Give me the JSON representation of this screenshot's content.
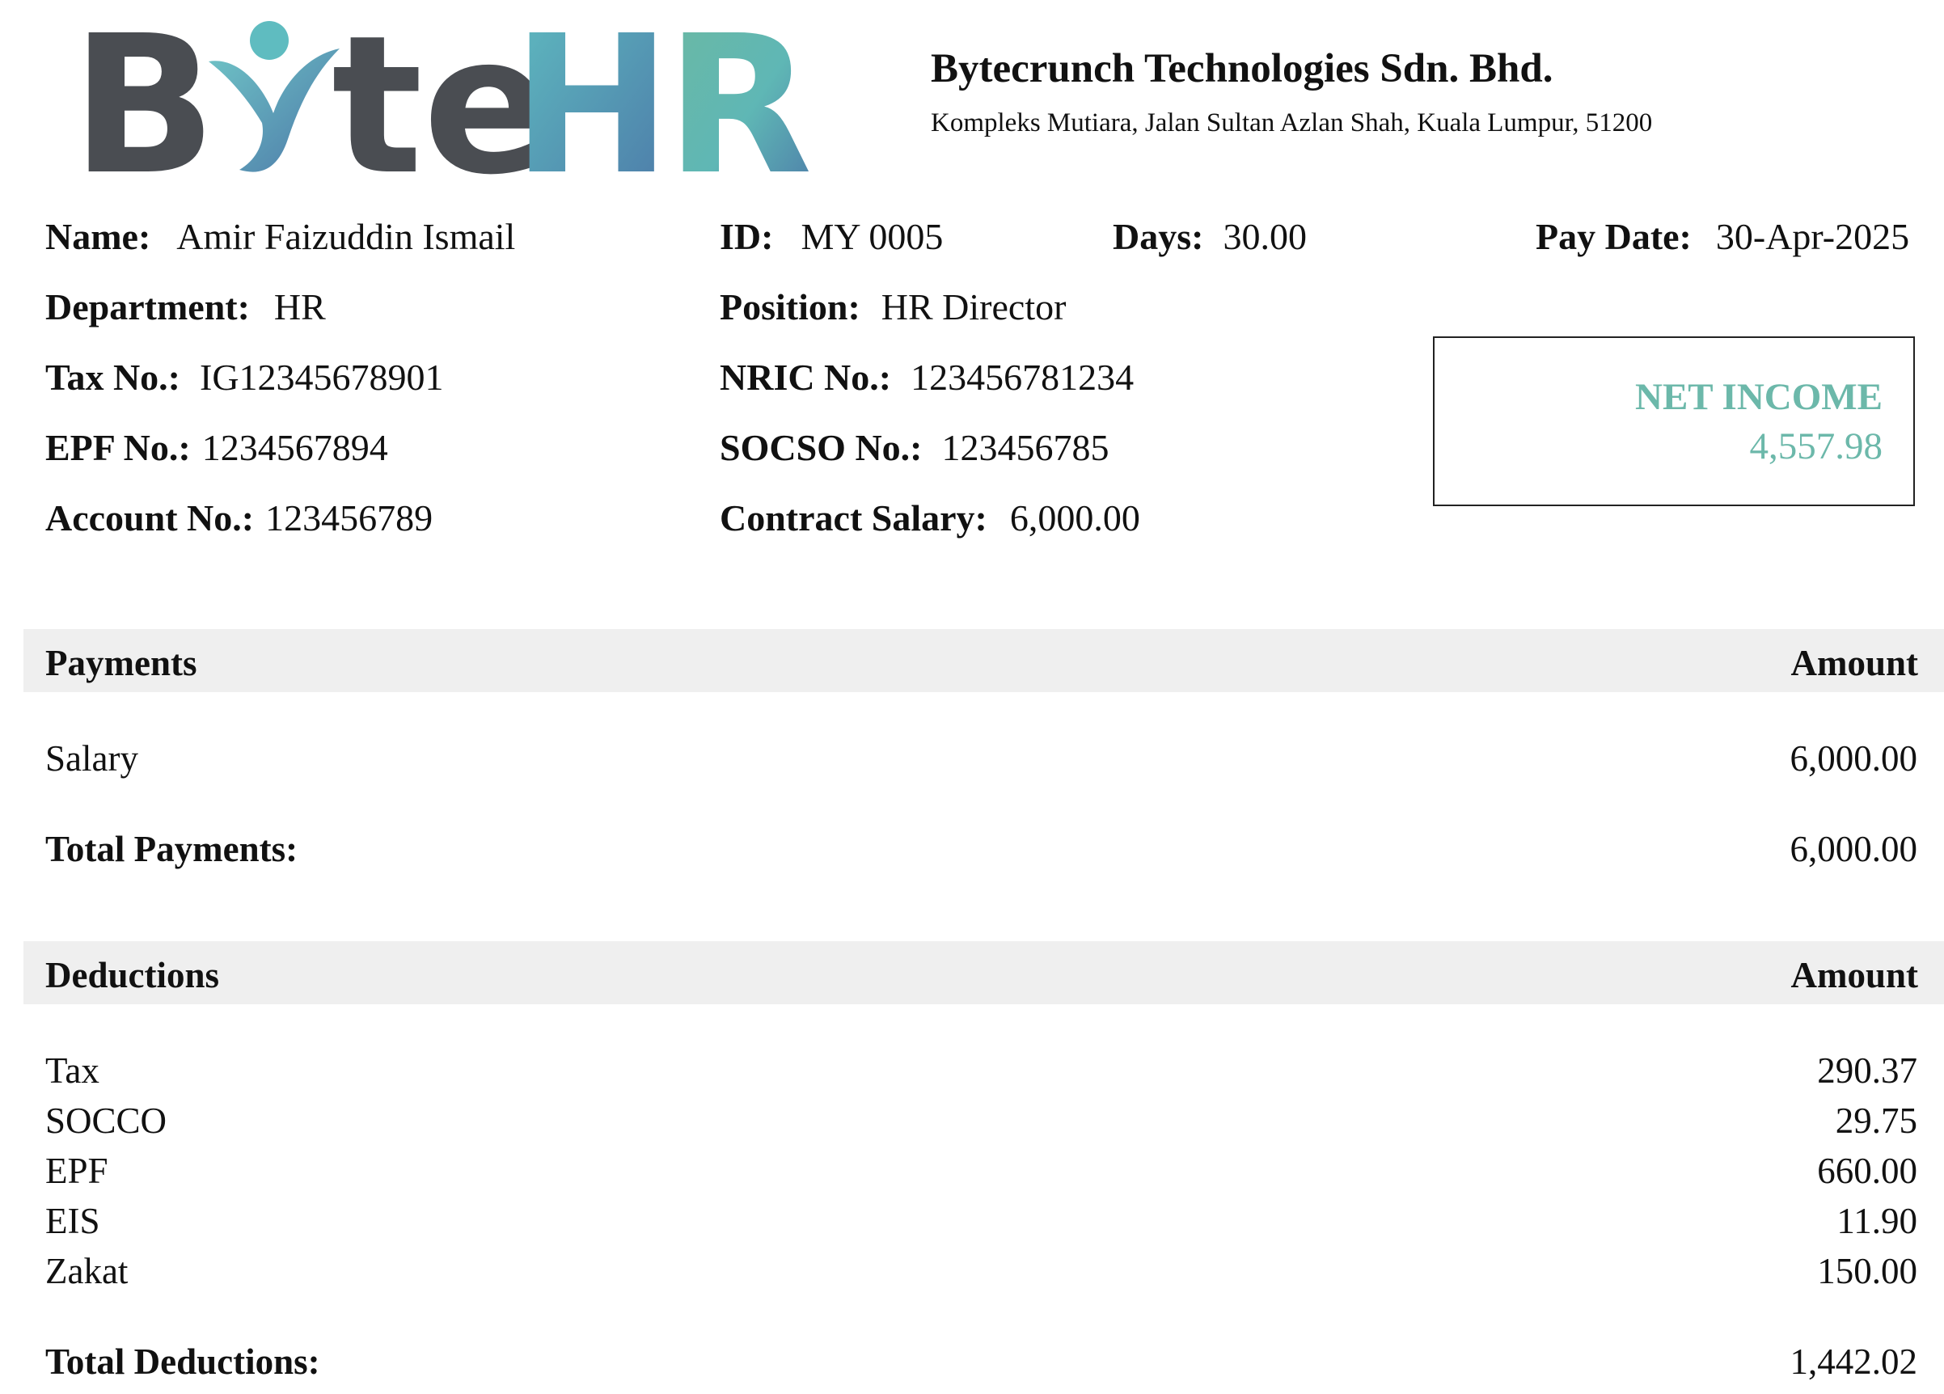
{
  "logo": {
    "text_byte": "ByteHR",
    "colors": {
      "dark": "#4a4d52",
      "teal": "#5fbcc0",
      "blue": "#4c78a8",
      "green": "#6cb8a2"
    }
  },
  "company": {
    "name": "Bytecrunch Technologies Sdn. Bhd.",
    "address": "Kompleks Mutiara, Jalan Sultan Azlan Shah, Kuala Lumpur, 51200"
  },
  "employee": {
    "name_label": "Name:",
    "name": "Amir Faizuddin Ismail",
    "id_label": "ID:",
    "id": "MY 0005",
    "days_label": "Days:",
    "days": "30.00",
    "pay_date_label": "Pay Date:",
    "pay_date": "30-Apr-2025",
    "department_label": "Department:",
    "department": "HR",
    "position_label": "Position:",
    "position": "HR Director",
    "tax_no_label": "Tax No.:",
    "tax_no": "IG12345678901",
    "nric_label": "NRIC No.:",
    "nric": "123456781234",
    "epf_label": "EPF No.:",
    "epf": "1234567894",
    "socso_label": "SOCSO No.:",
    "socso": "123456785",
    "account_label": "Account No.:",
    "account": "123456789",
    "contract_salary_label": "Contract Salary:",
    "contract_salary": "6,000.00"
  },
  "net_income": {
    "label": "NET INCOME",
    "value": "4,557.98",
    "color": "#6cb8aa"
  },
  "payments": {
    "header": "Payments",
    "amount_header": "Amount",
    "items": [
      {
        "label": "Salary",
        "amount": "6,000.00"
      }
    ],
    "total_label": "Total Payments:",
    "total": "6,000.00"
  },
  "deductions": {
    "header": "Deductions",
    "amount_header": "Amount",
    "items": [
      {
        "label": "Tax",
        "amount": "290.37"
      },
      {
        "label": "SOCCO",
        "amount": "29.75"
      },
      {
        "label": "EPF",
        "amount": "660.00"
      },
      {
        "label": "EIS",
        "amount": "11.90"
      },
      {
        "label": "Zakat",
        "amount": "150.00"
      }
    ],
    "total_label": "Total Deductions:",
    "total": "1,442.02"
  }
}
